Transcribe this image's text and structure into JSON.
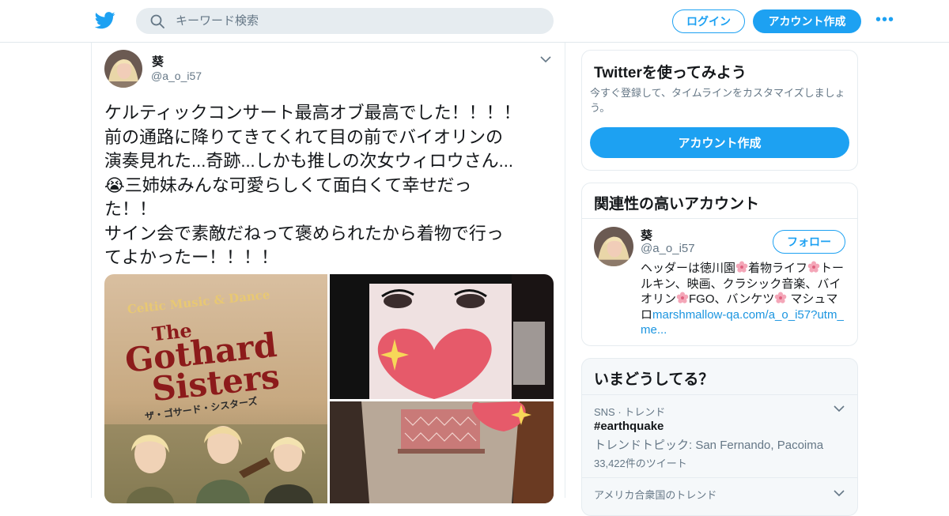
{
  "header": {
    "search_placeholder": "キーワード検索",
    "login_label": "ログイン",
    "signup_label": "アカウント作成",
    "more_label": "•••"
  },
  "tweet": {
    "author_name": "葵",
    "author_handle": "@a_o_i57",
    "text": "ケルティックコンサート最高オブ最高でした！！！！\n前の通路に降りてきてくれて目の前でバイオリンの\n演奏見れた...奇跡...しかも推しの次女ウィロウさん...\n😭三姉妹みんな可愛らしくて面白くて幸せだっ\nた！！\nサイン会で素敵だねって褒められたから着物で行っ\nてよかったー！！！！",
    "photo1": {
      "line1": "Celtic Music & Dance",
      "line2": "The",
      "line3": "Gothard",
      "line4": "Sisters",
      "katakana": "ザ・ゴサード・シスターズ"
    }
  },
  "signup_card": {
    "title": "Twitterを使ってみよう",
    "description": "今すぐ登録して、タイムラインをカスタマイズしましょう。",
    "button_label": "アカウント作成"
  },
  "related_card": {
    "title": "関連性の高いアカウント",
    "name": "葵",
    "handle": "@a_o_i57",
    "follow_label": "フォロー",
    "bio_1": "ヘッダーは徳川園",
    "bio_2": "着物ライフ",
    "bio_3": "トールキン、映画、クラシック音楽、バイオリン",
    "bio_4": "FGO、バンケツ",
    "bio_5": " マシュマロ",
    "bio_link": "marshmallow-qa.com/a_o_i57?utm_me..."
  },
  "trends_card": {
    "title": "いまどうしてる？",
    "trends": [
      {
        "context": "SNS · トレンド",
        "name": "#earthquake",
        "topic": "トレンドトピック: San Fernando, Pacoima",
        "count": "33,422件のツイート"
      },
      {
        "context": "アメリカ合衆国のトレンド"
      }
    ]
  },
  "colors": {
    "accent": "#1da1f2",
    "link": "#1b95e0",
    "secondary_text": "#657786",
    "border": "#e6ecf0"
  },
  "icons": [
    "twitter-bird-icon",
    "search-icon",
    "more-dots-icon",
    "chevron-down-icon",
    "cherry-blossom-icon",
    "crying-face-emoji"
  ]
}
